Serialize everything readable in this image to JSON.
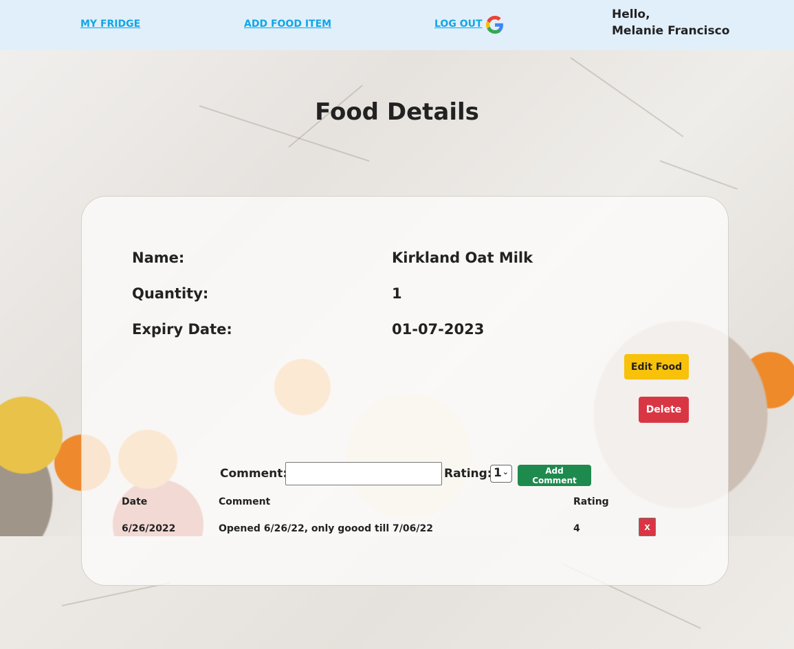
{
  "nav": {
    "my_fridge": "MY FRIDGE",
    "add_food_item": "ADD FOOD ITEM",
    "log_out": "LOG OUT",
    "greeting": "Hello,",
    "user_name": "Melanie Francisco",
    "link_color": "#10a6e6",
    "background": "#e1effb"
  },
  "page": {
    "title": "Food Details"
  },
  "food": {
    "name_label": "Name:",
    "name_value": "Kirkland Oat Milk",
    "quantity_label": "Quantity:",
    "quantity_value": "1",
    "expiry_label": "Expiry Date:",
    "expiry_value": "01-07-2023"
  },
  "actions": {
    "edit_label": "Edit Food",
    "delete_label": "Delete",
    "edit_color": "#f8c10a",
    "delete_color": "#d93644"
  },
  "comment_form": {
    "comment_label": "Comment:",
    "comment_value": "",
    "rating_label": "Rating:",
    "rating_selected": "1",
    "add_label": "Add Comment",
    "add_color": "#1e8a4e"
  },
  "comments_table": {
    "headers": [
      "Date",
      "Comment",
      "Rating"
    ],
    "rows": [
      {
        "date": "6/26/2022",
        "comment": "Opened 6/26/22, only goood till 7/06/22",
        "rating": "4",
        "delete_label": "x"
      }
    ]
  }
}
